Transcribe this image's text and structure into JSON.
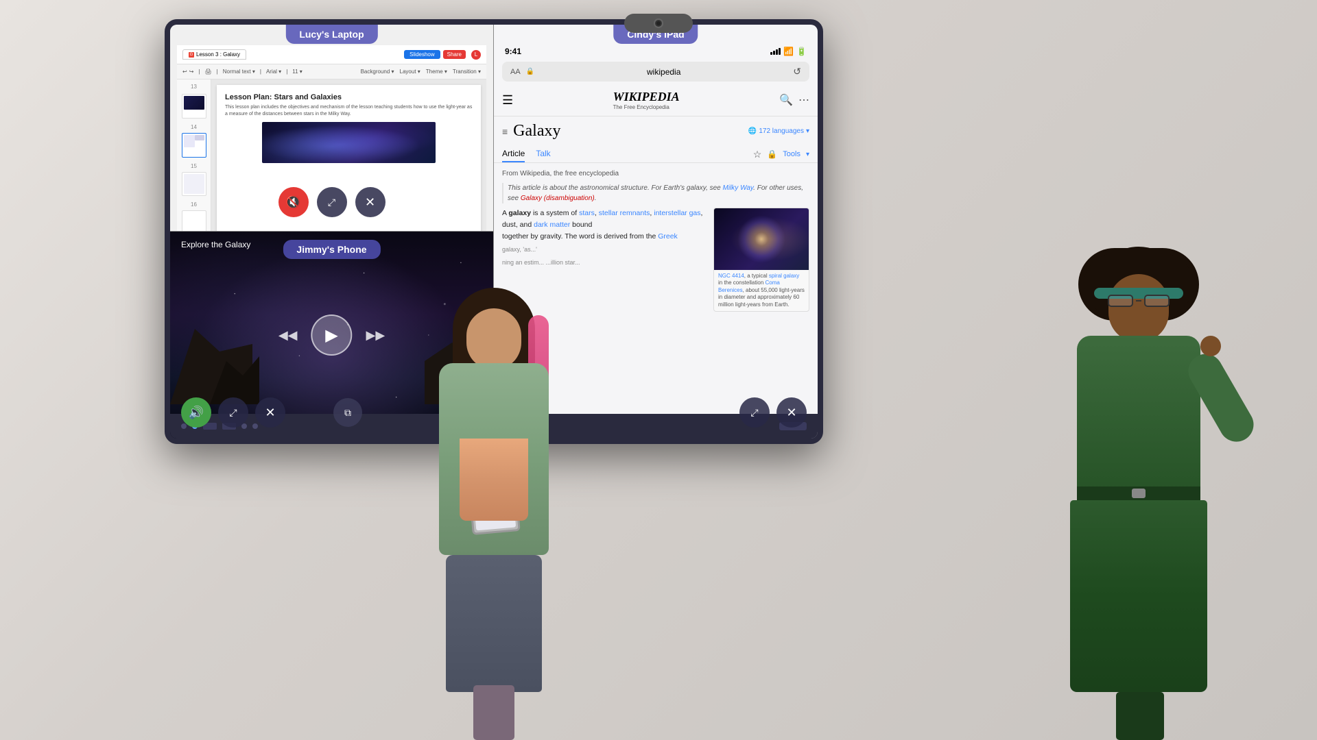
{
  "display": {
    "webcam_label": "webcam"
  },
  "lucy": {
    "label": "Lucy's Laptop",
    "tab_label": "Lesson 3 : Galaxy",
    "slideshow_btn": "Slideshow",
    "share_btn": "Share",
    "doc": {
      "title": "Lesson Plan: Stars and Galaxies",
      "subtitle": "This lesson plan includes the objectives and mechanism of the lesson teaching students how to use the light-year as a measure of the distances between stars in the Milky Way."
    },
    "controls": {
      "mute": "🔇",
      "compress": "⤢",
      "close": "✕"
    }
  },
  "jimmy": {
    "label": "Jimmy's Phone",
    "explore_label": "Explore the Galaxy",
    "controls": {
      "mute": "🔊",
      "compress": "⤢",
      "close": "✕",
      "pip": "⧉"
    }
  },
  "cindy": {
    "label": "Cindy's iPad",
    "status": {
      "time": "9:41",
      "url": "wikipedia"
    },
    "wiki": {
      "logo": "WIKIPEDIA",
      "logo_sub": "The Free Encyclopedia",
      "article_title": "Galaxy",
      "lang_count": "172 languages",
      "tab_article": "Article",
      "tab_talk": "Talk",
      "tools": "Tools",
      "from_text": "From Wikipedia, the free encyclopedia",
      "hatnote": "This article is about the astronomical structure. For Earth's galaxy, see Milky Way. For other uses, see Galaxy (disambiguation).",
      "body_start": "A galaxy is a system of stars, stellar remnants, interstellar gas, dust, and dark matter bound together by gravity.",
      "infobox_caption": "NGC 4414, a typical spiral galaxy in the constellation Coma Berenices, about 55,000 light-years in diameter and approximately 60 million light-years from Earth."
    },
    "controls": {
      "compress": "⤢",
      "close": "✕"
    }
  }
}
